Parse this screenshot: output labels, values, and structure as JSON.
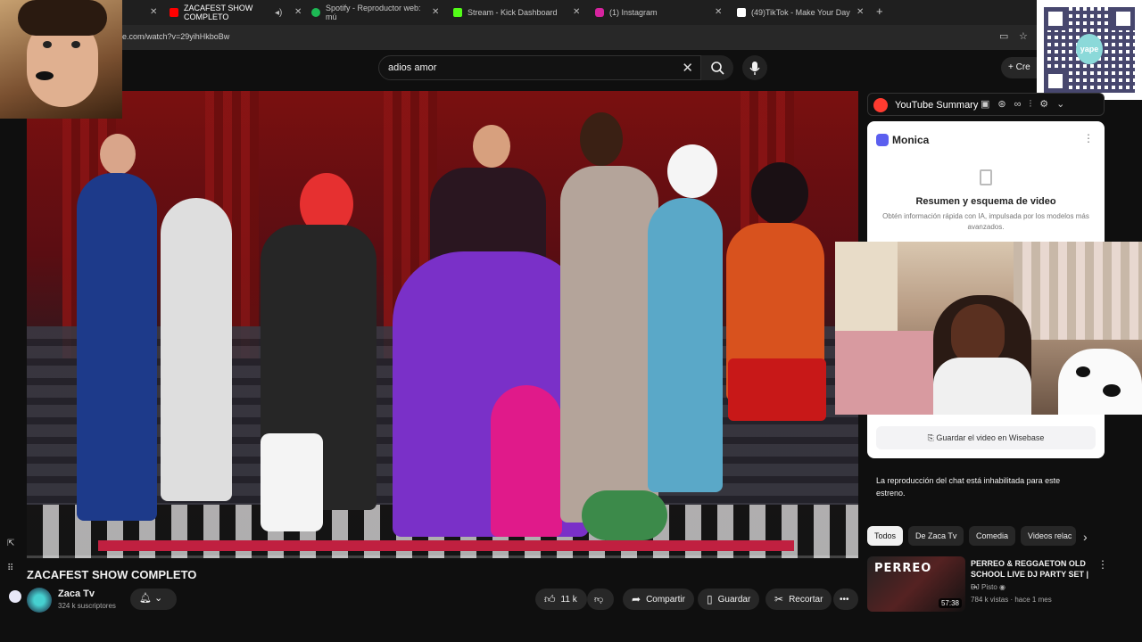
{
  "browser": {
    "tabs": [
      {
        "label": "ZACAFEST SHOW COMPLETO",
        "favicon": "youtube-icon",
        "color": "#ff0000",
        "active": true
      },
      {
        "label": "Spotify - Reproductor web: mú",
        "favicon": "spotify-icon",
        "color": "#1db954"
      },
      {
        "label": "Stream - Kick Dashboard",
        "favicon": "kick-icon",
        "color": "#53fc18"
      },
      {
        "label": "(1) Instagram",
        "favicon": "instagram-icon",
        "color": "#d6249f"
      },
      {
        "label": "(49)TikTok - Make Your Day",
        "favicon": "tiktok-icon",
        "color": "#ffffff"
      }
    ],
    "url": "e.com/watch?v=29yihHkboBw"
  },
  "header": {
    "search_value": "adios amor",
    "create_label": "Cre"
  },
  "video": {
    "title": "ZACAFEST SHOW COMPLETO",
    "channel_name": "Zaca Tv",
    "subscribers": "324 k suscriptores",
    "like_count": "11 k",
    "share_label": "Compartir",
    "save_label": "Guardar",
    "clip_label": "Recortar",
    "more_label": "•••"
  },
  "extension": {
    "title": "YouTube Summary"
  },
  "monica": {
    "title": "Monica",
    "heading": "Resumen y esquema de video",
    "description": "Obtén información rápida con IA, impulsada por los modelos más avanzados.",
    "save_button": "Guardar el video en Wisebase"
  },
  "chat": {
    "disabled_message": "La reproducción del chat está inhabilitada para este estreno."
  },
  "chips": [
    "Todos",
    "De Zaca Tv",
    "Comedia",
    "Videos relac"
  ],
  "recommendation": {
    "thumb_text": "PERREO",
    "title": "PERREO & REGGAETON OLD SCHOOL LIVE DJ PARTY SET | ...",
    "channel": "DJ Pisto",
    "meta": "784 k vistas · hace 1 mes",
    "duration": "57:38"
  },
  "qr": {
    "logo_text": "yape"
  }
}
